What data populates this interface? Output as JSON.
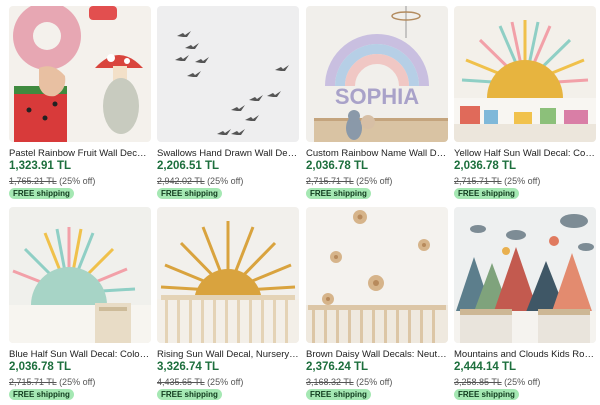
{
  "products": [
    {
      "title": "Pastel Rainbow Fruit Wall Decals:...",
      "price": "1,323.91 TL",
      "original_price": "1,765.21 TL",
      "discount": "(25% off)",
      "shipping": "FREE shipping"
    },
    {
      "title": "Swallows Hand Drawn Wall Decal...",
      "price": "2,206.51 TL",
      "original_price": "2,942.02 TL",
      "discount": "(25% off)",
      "shipping": "FREE shipping"
    },
    {
      "title": "Custom Rainbow Name Wall Dec...",
      "price": "2,036.78 TL",
      "original_price": "2,715.71 TL",
      "discount": "(25% off)",
      "shipping": "FREE shipping",
      "image_text": "SOPHIA"
    },
    {
      "title": "Yellow Half Sun Wall Decal: Colo...",
      "price": "2,036.78 TL",
      "original_price": "2,715.71 TL",
      "discount": "(25% off)",
      "shipping": "FREE shipping"
    },
    {
      "title": "Blue Half Sun Wall Decal: Colorfu...",
      "price": "2,036.78 TL",
      "original_price": "2,715.71 TL",
      "discount": "(25% off)",
      "shipping": "FREE shipping"
    },
    {
      "title": "Rising Sun Wall Decal, Nursery W...",
      "price": "3,326.74 TL",
      "original_price": "4,435.65 TL",
      "discount": "(25% off)",
      "shipping": "FREE shipping"
    },
    {
      "title": "Brown Daisy Wall Decals: Neutral...",
      "price": "2,376.24 TL",
      "original_price": "3,168.32 TL",
      "discount": "(25% off)",
      "shipping": "FREE shipping"
    },
    {
      "title": "Mountains and Clouds Kids Roo...",
      "price": "2,444.14 TL",
      "original_price": "3,258.85 TL",
      "discount": "(25% off)",
      "shipping": "FREE shipping"
    }
  ]
}
